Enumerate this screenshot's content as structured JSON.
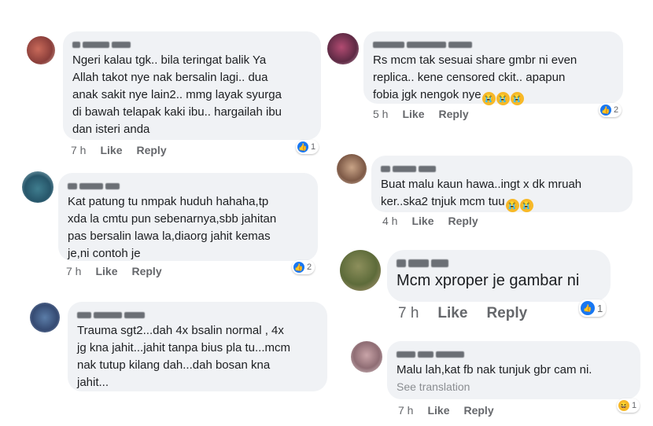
{
  "comments": [
    {
      "text": "Ngeri kalau tgk.. bila teringat balik Ya\nAllah takot nye nak bersalin lagi.. dua\nanak sakit nye lain2.. mmg layak syurga\ndi bawah telapak kaki ibu.. hargailah ibu\ndan isteri anda",
      "time": "7 h",
      "like": "Like",
      "reply": "Reply",
      "reaction_count": "1"
    },
    {
      "text": "Kat patung tu nmpak huduh hahaha,tp\nxda la cmtu pun sebenarnya,sbb jahitan\npas bersalin lawa la,diaorg jahit kemas\nje,ni contoh je",
      "time": "7 h",
      "like": "Like",
      "reply": "Reply",
      "reaction_count": "2"
    },
    {
      "text": "Trauma sgt2...dah 4x bsalin normal , 4x\njg kna jahit...jahit tanpa bius pla tu...mcm\nnak tutup kilang dah...dah bosan kna\njahit...",
      "time": "",
      "like": "",
      "reply": "",
      "reaction_count": ""
    },
    {
      "text": "Rs mcm tak sesuai share gmbr ni even\nreplica.. kene censored ckit.. apapun\nfobia jgk nengok nye",
      "time": "5 h",
      "like": "Like",
      "reply": "Reply",
      "reaction_count": "2"
    },
    {
      "text": "Buat malu kaun hawa..ingt x dk mruah\nker..ska2 tnjuk mcm tuu",
      "time": "4 h",
      "like": "Like",
      "reply": "Reply",
      "reaction_count": ""
    },
    {
      "text": "Mcm xproper je gambar ni",
      "time": "7 h",
      "like": "Like",
      "reply": "Reply",
      "reaction_count": "1"
    },
    {
      "text": "Malu lah,kat fb nak tunjuk gbr cam ni.",
      "see_translation": "See translation",
      "time": "7 h",
      "like": "Like",
      "reply": "Reply",
      "reaction_count": "1"
    }
  ],
  "icons": {
    "like": "thumbs-up-icon",
    "laugh": "laughing-emoji-icon",
    "cry": "crying-emoji-icon"
  },
  "colors": {
    "bubble": "#f0f2f5",
    "like_blue": "#1877f2",
    "meta_gray": "#65676b"
  }
}
